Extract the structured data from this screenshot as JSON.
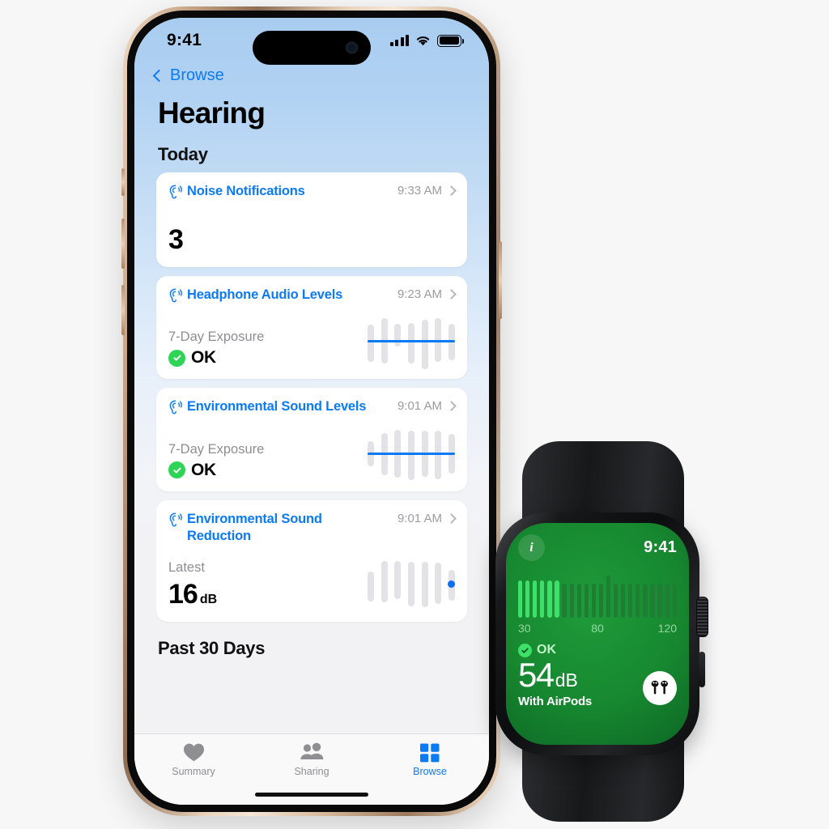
{
  "phone": {
    "status_bar": {
      "time": "9:41",
      "cellular_icon": "signal-bars-icon",
      "wifi_icon": "wifi-icon",
      "battery_icon": "battery-full-icon"
    },
    "nav": {
      "back_label": "Browse",
      "back_icon": "chevron-left-icon"
    },
    "page_title": "Hearing",
    "sections": [
      {
        "title": "Today"
      },
      {
        "title": "Past 30 Days"
      }
    ],
    "cards": [
      {
        "icon": "ear-icon",
        "title": "Noise Notifications",
        "time": "9:33 AM",
        "disclosure_icon": "chevron-right-icon",
        "value": "3"
      },
      {
        "icon": "ear-icon",
        "title": "Headphone Audio Levels",
        "time": "9:23 AM",
        "disclosure_icon": "chevron-right-icon",
        "metric_label": "7-Day Exposure",
        "status": "OK",
        "status_icon": "check-circle-icon",
        "status_color": "#2fd457"
      },
      {
        "icon": "ear-icon",
        "title": "Environmental Sound Levels",
        "time": "9:01 AM",
        "disclosure_icon": "chevron-right-icon",
        "metric_label": "7-Day Exposure",
        "status": "OK",
        "status_icon": "check-circle-icon",
        "status_color": "#2fd457"
      },
      {
        "icon": "ear-icon",
        "title": "Environmental Sound Reduction",
        "time": "9:01 AM",
        "disclosure_icon": "chevron-right-icon",
        "metric_label": "Latest",
        "value": "16",
        "unit": "dB"
      }
    ],
    "tabbar": {
      "tabs": [
        {
          "label": "Summary",
          "icon": "heart-icon",
          "active": false
        },
        {
          "label": "Sharing",
          "icon": "people-icon",
          "active": false
        },
        {
          "label": "Browse",
          "icon": "grid-squares-icon",
          "active": true
        }
      ],
      "active_color": "#0b7bf5",
      "inactive_color": "#8e8e93"
    },
    "accent_color": "#0b7bf5"
  },
  "watch": {
    "time": "9:41",
    "info_icon": "info-icon",
    "status": "OK",
    "status_icon": "check-circle-icon",
    "decibels": "54",
    "unit": "dB",
    "source": "With AirPods",
    "airpods_icon": "airpods-icon",
    "screen_color": "#17883 0",
    "active_bar_color": "#3fe06a"
  },
  "chart_data": [
    {
      "type": "bar",
      "name": "headphone-audio-levels-sparkline",
      "title": "Headphone Audio Levels 7-Day Exposure",
      "categories": [
        "1",
        "2",
        "3",
        "4",
        "5",
        "6",
        "7"
      ],
      "values": [
        72,
        88,
        44,
        78,
        96,
        84,
        70
      ],
      "offsets": [
        -6,
        4,
        26,
        -4,
        -10,
        6,
        0
      ],
      "threshold_line": 50,
      "bar_color": "#e3e3e7",
      "line_color": "#0b7bf5",
      "grid": false,
      "legend": null
    },
    {
      "type": "bar",
      "name": "environmental-sound-levels-sparkline",
      "title": "Environmental Sound Levels 7-Day Exposure",
      "categories": [
        "1",
        "2",
        "3",
        "4",
        "5",
        "6",
        "7"
      ],
      "values": [
        48,
        82,
        92,
        96,
        90,
        94,
        76
      ],
      "offsets": [
        2,
        0,
        2,
        -4,
        0,
        -2,
        2
      ],
      "threshold_line": 50,
      "bar_color": "#e3e3e7",
      "line_color": "#0b7bf5",
      "grid": false,
      "legend": null
    },
    {
      "type": "bar",
      "name": "environmental-sound-reduction-sparkline",
      "title": "Environmental Sound Reduction Latest",
      "categories": [
        "1",
        "2",
        "3",
        "4",
        "5",
        "6",
        "7"
      ],
      "values": [
        58,
        80,
        74,
        86,
        88,
        80,
        60
      ],
      "offsets": [
        -8,
        10,
        16,
        2,
        0,
        6,
        -2
      ],
      "latest_marker": {
        "index": 6,
        "color": "#0b6ff0"
      },
      "bar_color": "#e3e3e7",
      "grid": false,
      "legend": null
    },
    {
      "type": "bar",
      "name": "watch-noise-meter",
      "title": "Environmental Sound Level Meter",
      "xlabel": "dB",
      "tick_labels": [
        "30",
        "80",
        "120"
      ],
      "tick_positions": [
        0,
        50,
        92
      ],
      "xlim": [
        30,
        120
      ],
      "current_value": 54,
      "active_bars": 6,
      "total_bars": 22,
      "values": [
        88,
        88,
        88,
        88,
        88,
        88,
        82,
        82,
        82,
        82,
        82,
        82,
        100,
        82,
        82,
        82,
        82,
        82,
        82,
        82,
        82,
        82
      ],
      "active_color": "#3fe06a",
      "inactive_color": "#1d7e34",
      "grid": false,
      "legend": null
    }
  ]
}
